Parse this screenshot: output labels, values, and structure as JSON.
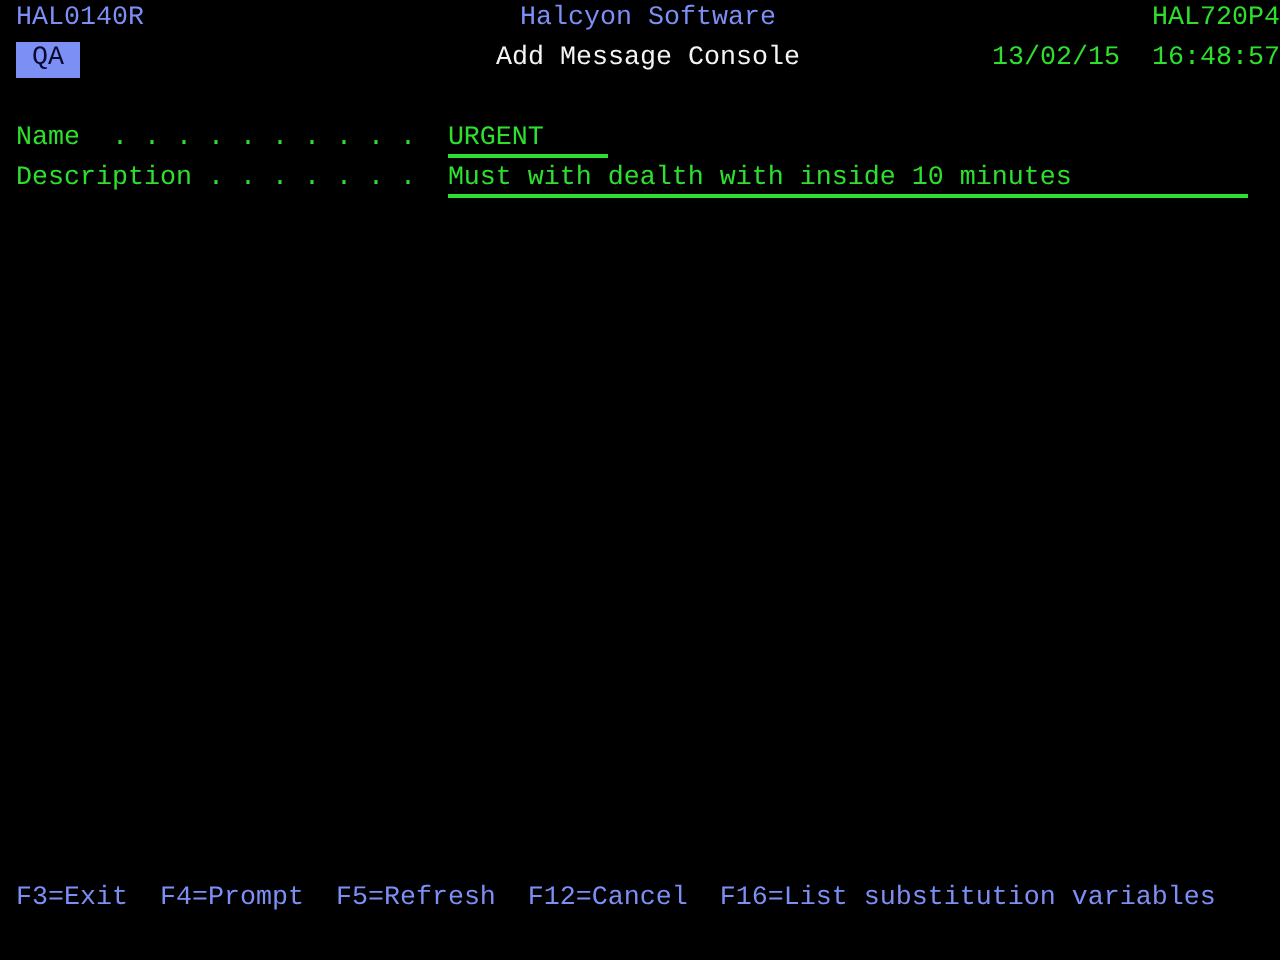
{
  "header": {
    "program": "HAL0140R",
    "company": "Halcyon Software",
    "system": "HAL720P4",
    "environment": "QA",
    "title": "Add Message Console",
    "date": "13/02/15",
    "time": "16:48:57"
  },
  "fields": [
    {
      "label": "Name  . . . . . . . . . .",
      "value": "URGENT"
    },
    {
      "label": "Description . . . . . . .",
      "value": "Must with dealth with inside 10 minutes"
    }
  ],
  "function_keys": [
    "F3=Exit",
    "F4=Prompt",
    "F5=Refresh",
    "F12=Cancel",
    "F16=List substitution variables"
  ]
}
